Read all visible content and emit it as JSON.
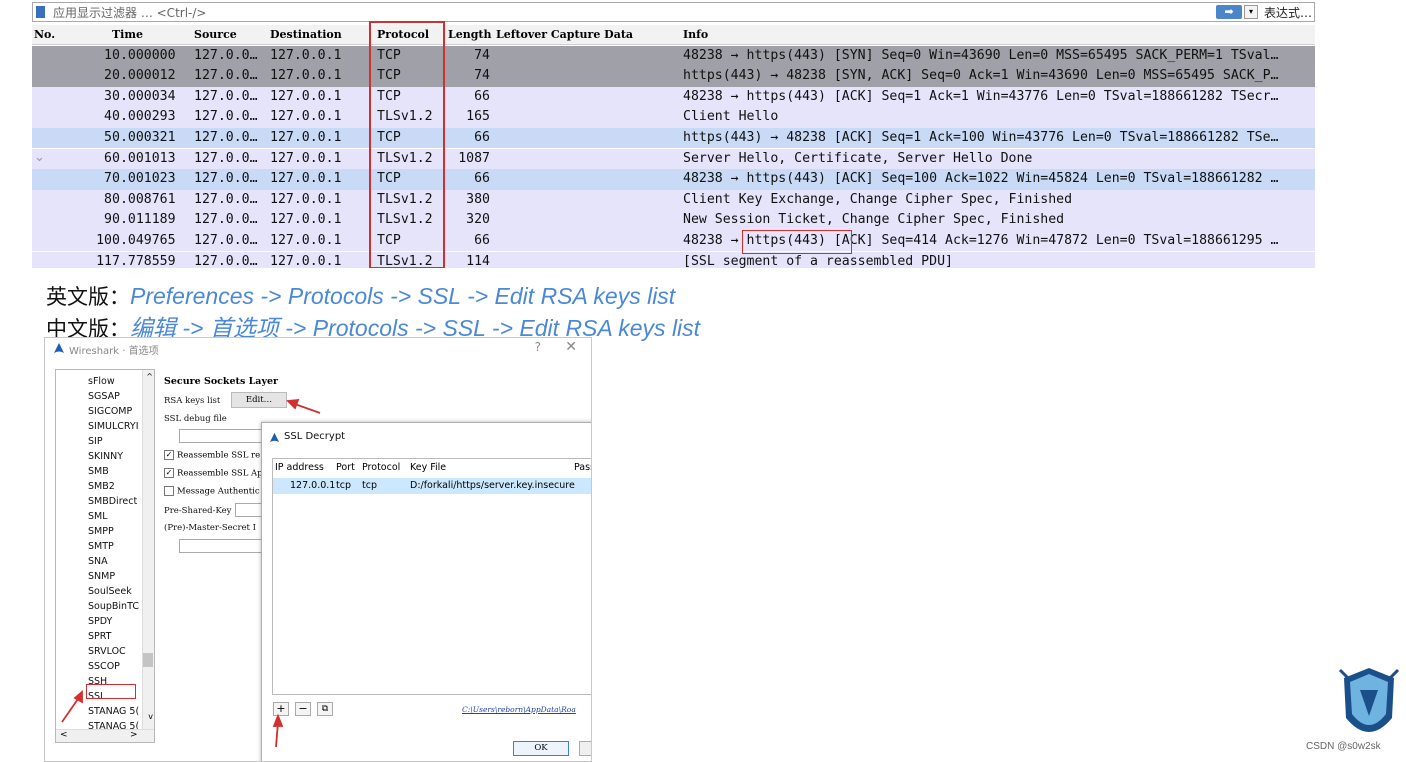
{
  "filter": {
    "placeholder": "应用显示过滤器 … <Ctrl-/>",
    "apply_icon": "arrow-right-icon",
    "dropdown": "▾",
    "expression_label": "表达式…"
  },
  "columns": {
    "no": "No.",
    "time": "Time",
    "source": "Source",
    "destination": "Destination",
    "protocol": "Protocol",
    "length": "Length",
    "leftover": "Leftover Capture Data",
    "info": "Info"
  },
  "packets": [
    {
      "no": "1",
      "time": "0.000000",
      "src": "127.0.0…",
      "dst": "127.0.0.1",
      "proto": "TCP",
      "len": "74",
      "info": "48238 → https(443) [SYN] Seq=0 Win=43690 Len=0 MSS=65495 SACK_PERM=1 TSval…"
    },
    {
      "no": "2",
      "time": "0.000012",
      "src": "127.0.0…",
      "dst": "127.0.0.1",
      "proto": "TCP",
      "len": "74",
      "info": "https(443) → 48238 [SYN, ACK] Seq=0 Ack=1 Win=43690 Len=0 MSS=65495 SACK_P…"
    },
    {
      "no": "3",
      "time": "0.000034",
      "src": "127.0.0…",
      "dst": "127.0.0.1",
      "proto": "TCP",
      "len": "66",
      "info": "48238 → https(443) [ACK] Seq=1 Ack=1 Win=43776 Len=0 TSval=188661282 TSecr…"
    },
    {
      "no": "4",
      "time": "0.000293",
      "src": "127.0.0…",
      "dst": "127.0.0.1",
      "proto": "TLSv1.2",
      "len": "165",
      "info": "Client Hello"
    },
    {
      "no": "5",
      "time": "0.000321",
      "src": "127.0.0…",
      "dst": "127.0.0.1",
      "proto": "TCP",
      "len": "66",
      "info": "https(443) → 48238 [ACK] Seq=1 Ack=100 Win=43776 Len=0 TSval=188661282 TSe…"
    },
    {
      "no": "6",
      "time": "0.001013",
      "src": "127.0.0…",
      "dst": "127.0.0.1",
      "proto": "TLSv1.2",
      "len": "1087",
      "info": "Server Hello, Certificate, Server Hello Done"
    },
    {
      "no": "7",
      "time": "0.001023",
      "src": "127.0.0…",
      "dst": "127.0.0.1",
      "proto": "TCP",
      "len": "66",
      "info": "48238 → https(443) [ACK] Seq=100 Ack=1022 Win=45824 Len=0 TSval=188661282 …"
    },
    {
      "no": "8",
      "time": "0.008761",
      "src": "127.0.0…",
      "dst": "127.0.0.1",
      "proto": "TLSv1.2",
      "len": "380",
      "info": "Client Key Exchange, Change Cipher Spec, Finished"
    },
    {
      "no": "9",
      "time": "0.011189",
      "src": "127.0.0…",
      "dst": "127.0.0.1",
      "proto": "TLSv1.2",
      "len": "320",
      "info": "New Session Ticket, Change Cipher Spec, Finished"
    },
    {
      "no": "10",
      "time": "0.049765",
      "src": "127.0.0…",
      "dst": "127.0.0.1",
      "proto": "TCP",
      "len": "66",
      "info": "48238 → https(443) [ACK] Seq=414 Ack=1276 Win=47872 Len=0 TSval=188661295 …"
    },
    {
      "no": "11",
      "time": "7.778559",
      "src": "127.0.0…",
      "dst": "127.0.0.1",
      "proto": "TLSv1.2",
      "len": "114",
      "info": "[SSL segment of a reassembled PDU]"
    }
  ],
  "row_colors": {
    "gray": "#a0a0a8",
    "lavender": "#e6e4fb",
    "blue": "#c9daf7"
  },
  "instructions": {
    "en_label": "英文版：",
    "en_path": "Preferences -> Protocols -> SSL -> Edit RSA keys list",
    "zh_label": "中文版：",
    "zh_path": "编辑 -> 首选项 -> Protocols -> SSL -> Edit RSA keys list"
  },
  "prefs": {
    "title": "Wireshark · 首选项",
    "help": "?",
    "close": "✕",
    "tree_items": [
      "sFlow",
      "SGSAP",
      "SIGCOMP",
      "SIMULCRYI",
      "SIP",
      "SKINNY",
      "SMB",
      "SMB2",
      "SMBDirect",
      "SML",
      "SMPP",
      "SMTP",
      "SNA",
      "SNMP",
      "SoulSeek",
      "SoupBinTC",
      "SPDY",
      "SPRT",
      "SRVLOC",
      "SSCOP",
      "SSH",
      "SSL",
      "STANAG 5(",
      "STANAG 5("
    ],
    "scroll_up": "^",
    "scroll_down": "v",
    "scroll_left": "<",
    "scroll_right": ">",
    "panel_title": "Secure Sockets Layer",
    "rsa_keys_label": "RSA keys list",
    "edit_button": "Edit…",
    "debug_file_label": "SSL debug file",
    "reassemble_1": "Reassemble SSL re",
    "reassemble_2": "Reassemble SSL Ap",
    "message_auth": "Message Authentic",
    "psk_label": "Pre-Shared-Key",
    "master_secret_label": "(Pre)-Master-Secret I"
  },
  "ssl_decrypt": {
    "title": "SSL Decrypt",
    "columns": {
      "ip": "IP address",
      "port": "Port",
      "protocol": "Protocol",
      "key_file": "Key File",
      "password": "Pass"
    },
    "entry": {
      "ip": "127.0.0.1",
      "port": "tcp",
      "protocol": "tcp",
      "key_file": "D:/forkali/https/server.key.insecure"
    },
    "add": "+",
    "remove": "−",
    "copy": "⧉",
    "config_path": "C:\\Users\\reborn\\AppData\\Roa",
    "ok": "OK"
  },
  "watermark": {
    "text": "CSDN @s0w2sk"
  },
  "accent": {
    "highlight_red": "#d23030",
    "path_blue": "#4a88d8"
  }
}
